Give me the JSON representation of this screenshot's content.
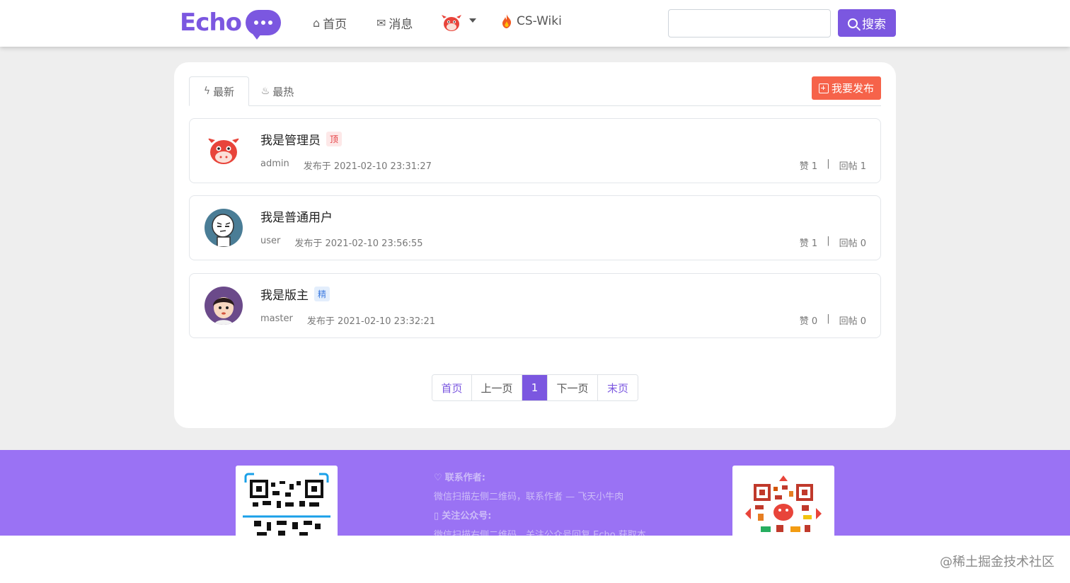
{
  "header": {
    "logo_text": "Echo",
    "nav": {
      "home": "首页",
      "messages": "消息",
      "wiki": "CS-Wiki"
    },
    "search": {
      "placeholder": "",
      "button_label": "搜索"
    }
  },
  "tabs": {
    "latest": "最新",
    "hottest": "最热",
    "publish_label": "我要发布"
  },
  "posts": [
    {
      "title": "我是管理员",
      "badge": "顶",
      "author": "admin",
      "published": "发布于 2021-02-10 23:31:27",
      "likes": "赞 1",
      "replies": "回帖 1"
    },
    {
      "title": "我是普通用户",
      "badge": "",
      "author": "user",
      "published": "发布于 2021-02-10 23:56:55",
      "likes": "赞 1",
      "replies": "回帖 0"
    },
    {
      "title": "我是版主",
      "badge": "精",
      "author": "master",
      "published": "发布于 2021-02-10 23:32:21",
      "likes": "赞 0",
      "replies": "回帖 0"
    }
  ],
  "pagination": {
    "first": "首页",
    "prev": "上一页",
    "current": "1",
    "next": "下一页",
    "last": "末页"
  },
  "footer": {
    "contact_heading": "联系作者:",
    "contact_text": "微信扫描左侧二维码，联系作者 — 飞天小牛肉",
    "account_heading": "关注公众号:",
    "account_text": "微信扫描右侧二维码，关注公众号回复 Echo 获取本"
  },
  "watermark": "@稀土掘金技术社区",
  "colors": {
    "brand": "#7b57e0",
    "publish": "#f6634a",
    "footer": "#9a72f4"
  }
}
